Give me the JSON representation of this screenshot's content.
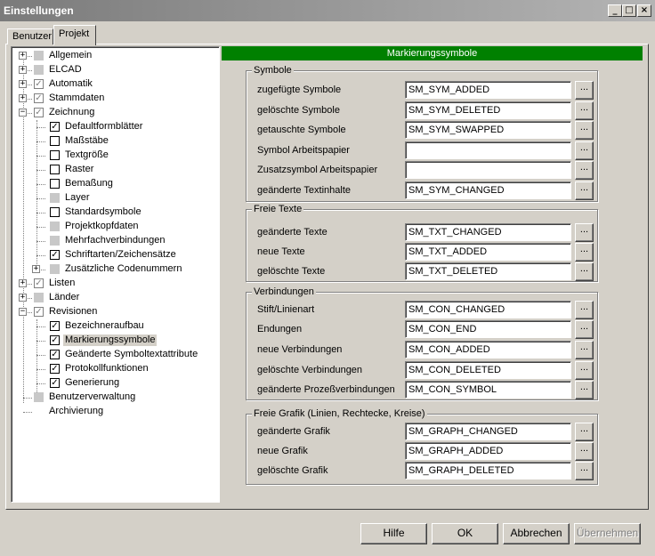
{
  "window": {
    "title": "Einstellungen",
    "minimize": "_",
    "maximize": "□",
    "close": "×"
  },
  "tabs": [
    {
      "label": "Benutzer",
      "active": false
    },
    {
      "label": "Projekt",
      "active": true
    }
  ],
  "tree": {
    "items": [
      {
        "label": "Allgemein",
        "expander": "+",
        "check": "gray"
      },
      {
        "label": "ELCAD",
        "expander": "+",
        "check": "gray"
      },
      {
        "label": "Automatik",
        "expander": "+",
        "check": "checked-gray"
      },
      {
        "label": "Stammdaten",
        "expander": "+",
        "check": "checked-gray"
      },
      {
        "label": "Zeichnung",
        "expander": "−",
        "check": "checked-gray"
      },
      {
        "label": "Defaultformblätter",
        "check": "checked"
      },
      {
        "label": "Maßstäbe",
        "check": "empty"
      },
      {
        "label": "Textgröße",
        "check": "empty"
      },
      {
        "label": "Raster",
        "check": "empty"
      },
      {
        "label": "Bemaßung",
        "check": "empty"
      },
      {
        "label": "Layer",
        "check": "gray"
      },
      {
        "label": "Standardsymbole",
        "check": "empty"
      },
      {
        "label": "Projektkopfdaten",
        "check": "gray"
      },
      {
        "label": "Mehrfachverbindungen",
        "check": "gray"
      },
      {
        "label": "Schriftarten/Zeichensätze",
        "check": "checked"
      },
      {
        "label": "Zusätzliche Codenummern",
        "expander": "+",
        "check": "gray"
      },
      {
        "label": "Listen",
        "expander": "+",
        "check": "checked-gray"
      },
      {
        "label": "Länder",
        "expander": "+",
        "check": "gray"
      },
      {
        "label": "Revisionen",
        "expander": "−",
        "check": "checked-gray"
      },
      {
        "label": "Bezeichneraufbau",
        "check": "checked"
      },
      {
        "label": "Markierungssymbole",
        "check": "checked",
        "selected": true
      },
      {
        "label": "Geänderte Symboltextattribute",
        "check": "checked"
      },
      {
        "label": "Protokollfunktionen",
        "check": "checked"
      },
      {
        "label": "Generierung",
        "check": "checked"
      },
      {
        "label": "Benutzerverwaltung",
        "check": "gray"
      },
      {
        "label": "Archivierung",
        "check": "none"
      }
    ]
  },
  "header": {
    "title": "Markierungssymbole"
  },
  "groups": [
    {
      "title": "Symbole",
      "rows": [
        {
          "label": "zugefügte Symbole",
          "value": "SM_SYM_ADDED"
        },
        {
          "label": "gelöschte Symbole",
          "value": "SM_SYM_DELETED"
        },
        {
          "label": "getauschte Symbole",
          "value": "SM_SYM_SWAPPED"
        },
        {
          "label": "Symbol Arbeitspapier",
          "value": ""
        },
        {
          "label": "Zusatzsymbol Arbeitspapier",
          "value": ""
        },
        {
          "label": "geänderte Textinhalte",
          "value": "SM_SYM_CHANGED"
        }
      ]
    },
    {
      "title": "Freie Texte",
      "rows": [
        {
          "label": "geänderte Texte",
          "value": "SM_TXT_CHANGED"
        },
        {
          "label": "neue Texte",
          "value": "SM_TXT_ADDED"
        },
        {
          "label": "gelöschte Texte",
          "value": "SM_TXT_DELETED"
        }
      ]
    },
    {
      "title": "Verbindungen",
      "rows": [
        {
          "label": "Stift/Linienart",
          "value": "SM_CON_CHANGED"
        },
        {
          "label": "Endungen",
          "value": "SM_CON_END"
        },
        {
          "label": "neue Verbindungen",
          "value": "SM_CON_ADDED"
        },
        {
          "label": "gelöschte Verbindungen",
          "value": "SM_CON_DELETED"
        },
        {
          "label": "geänderte Prozeßverbindungen",
          "value": "SM_CON_SYMBOL"
        }
      ]
    },
    {
      "title": "Freie Grafik (Linien, Rechtecke, Kreise)",
      "rows": [
        {
          "label": "geänderte Grafik",
          "value": "SM_GRAPH_CHANGED"
        },
        {
          "label": "neue Grafik",
          "value": "SM_GRAPH_ADDED"
        },
        {
          "label": "gelöschte Grafik",
          "value": "SM_GRAPH_DELETED"
        }
      ]
    }
  ],
  "browse_label": "...",
  "buttons": {
    "help": "Hilfe",
    "ok": "OK",
    "cancel": "Abbrechen",
    "apply": "Übernehmen"
  }
}
